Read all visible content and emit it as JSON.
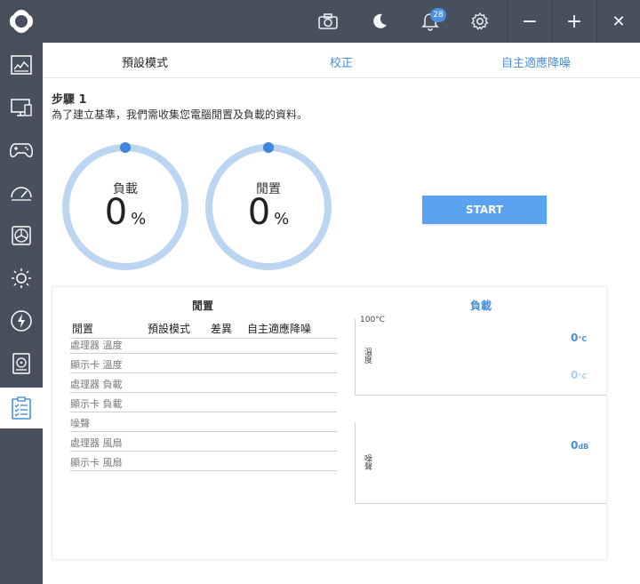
{
  "topbar": {
    "icons": [
      "logo-icon",
      "camera-icon",
      "moon-icon",
      "bell-icon",
      "gear-icon"
    ],
    "notification_count": "28",
    "window_controls": {
      "minimize": "−",
      "maximize": "+",
      "close": "✕"
    }
  },
  "sidebar": {
    "items": [
      {
        "icon": "dashboard-icon"
      },
      {
        "icon": "monitor-icon"
      },
      {
        "icon": "gamepad-icon"
      },
      {
        "icon": "speedometer-icon"
      },
      {
        "icon": "fan-icon"
      },
      {
        "icon": "sun-icon"
      },
      {
        "icon": "lightning-icon"
      },
      {
        "icon": "storage-icon"
      },
      {
        "icon": "clipboard-checklist-icon",
        "active": true
      }
    ]
  },
  "tabs": [
    {
      "label": "預設模式",
      "active": true
    },
    {
      "label": "校正",
      "active": false
    },
    {
      "label": "自主適應降噪",
      "active": false
    }
  ],
  "step": {
    "title": "步驟 1",
    "description": "為了建立基準，我們需收集您電腦閒置及負載的資料。"
  },
  "gauges": [
    {
      "label": "負載",
      "value": "0",
      "unit": "%"
    },
    {
      "label": "閒置",
      "value": "0",
      "unit": "%"
    }
  ],
  "start_button": "START",
  "panel": {
    "left_title": "閒置",
    "right_title": "負載",
    "table": {
      "headers": [
        "閒置",
        "預設模式",
        "差異",
        "自主適應降噪"
      ],
      "rows": [
        "處理器 溫度",
        "顯示卡 溫度",
        "處理器 負載",
        "顯示卡 負載",
        "噪聲",
        "處理器 風扇",
        "顯示卡 風扇"
      ]
    },
    "temp_chart": {
      "top_label": "100°C",
      "y_label": "溫度",
      "value1": "0",
      "unit1": "°C",
      "value2": "0",
      "unit2": "°C"
    },
    "noise_chart": {
      "y_label": "噪聲",
      "value": "0",
      "unit": "dB"
    }
  },
  "colors": {
    "sidebar_bg": "#48505e",
    "accent": "#4a8fd8",
    "gauge_ring": "#bcd6f2",
    "gauge_dot": "#3f86dc",
    "start_button": "#5ba3f0"
  }
}
